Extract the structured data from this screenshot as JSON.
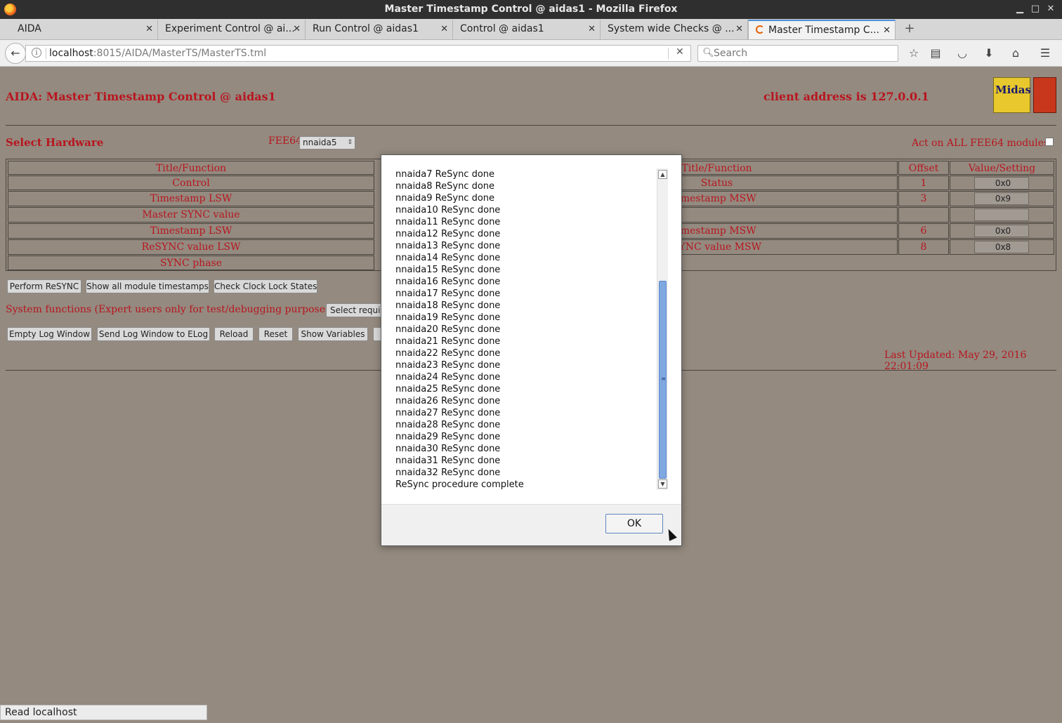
{
  "window": {
    "title": "Master Timestamp Control @ aidas1 - Mozilla Firefox"
  },
  "tabs": [
    {
      "label": "AIDA"
    },
    {
      "label": "Experiment Control @ ai..."
    },
    {
      "label": "Run Control @ aidas1"
    },
    {
      "label": "Control @ aidas1"
    },
    {
      "label": "System wide Checks @ ..."
    },
    {
      "label": "Master Timestamp C..."
    }
  ],
  "nav": {
    "url_host": "localhost",
    "url_rest": ":8015/AIDA/MasterTS/MasterTS.tml",
    "search_placeholder": "Search"
  },
  "page": {
    "title": "AIDA: Master Timestamp Control @ aidas1",
    "client_address": "client address is 127.0.0.1",
    "logo_text": "Midas",
    "select_hardware": "Select Hardware",
    "fee64_label": "FEE64",
    "fee64_selected": "nnaida5",
    "act_all_label": "Act on ALL FEE64 modules?",
    "table": {
      "left_header": "Title/Function",
      "right_header": "Title/Function",
      "offset_header": "Offset",
      "value_header": "Value/Setting",
      "left_rows": [
        "Control",
        "Timestamp LSW",
        "Master SYNC value",
        "Timestamp LSW",
        "ReSYNC value LSW",
        "SYNC phase"
      ],
      "right_rows": [
        {
          "title": "Status",
          "offset": "1",
          "value": "0x0"
        },
        {
          "title": "imestamp MSW",
          "offset": "3",
          "value": "0x9"
        },
        {
          "title": "",
          "offset": "",
          "value": ""
        },
        {
          "title": "imestamp MSW",
          "offset": "6",
          "value": "0x0"
        },
        {
          "title": "SYNC value MSW",
          "offset": "8",
          "value": "0x8"
        }
      ]
    },
    "buttons": {
      "perform_resync": "Perform ReSYNC",
      "show_timestamps": "Show all module timestamps",
      "check_clock": "Check Clock Lock States",
      "select_required": "Select require",
      "empty_log": "Empty Log Window",
      "send_log": "Send Log Window to ELog",
      "reload": "Reload",
      "reset": "Reset",
      "show_variables": "Show Variables"
    },
    "system_functions": "System functions (Expert users only for test/debugging purposes!!!)",
    "last_updated": "Last Updated: May 29, 2016 22:01:09"
  },
  "status_bar": {
    "text": "Read localhost"
  },
  "dialog": {
    "lines": [
      "nnaida7 ReSync done",
      "nnaida8 ReSync done",
      "nnaida9 ReSync done",
      "nnaida10 ReSync done",
      "nnaida11 ReSync done",
      "nnaida12 ReSync done",
      "nnaida13 ReSync done",
      "nnaida14 ReSync done",
      "nnaida15 ReSync done",
      "nnaida16 ReSync done",
      "nnaida17 ReSync done",
      "nnaida18 ReSync done",
      "nnaida19 ReSync done",
      "nnaida20 ReSync done",
      "nnaida21 ReSync done",
      "nnaida22 ReSync done",
      "nnaida23 ReSync done",
      "nnaida24 ReSync done",
      "nnaida25 ReSync done",
      "nnaida26 ReSync done",
      "nnaida27 ReSync done",
      "nnaida28 ReSync done",
      "nnaida29 ReSync done",
      "nnaida30 ReSync done",
      "nnaida31 ReSync done",
      "nnaida32 ReSync done",
      "ReSync procedure complete"
    ],
    "ok_label": "OK"
  }
}
